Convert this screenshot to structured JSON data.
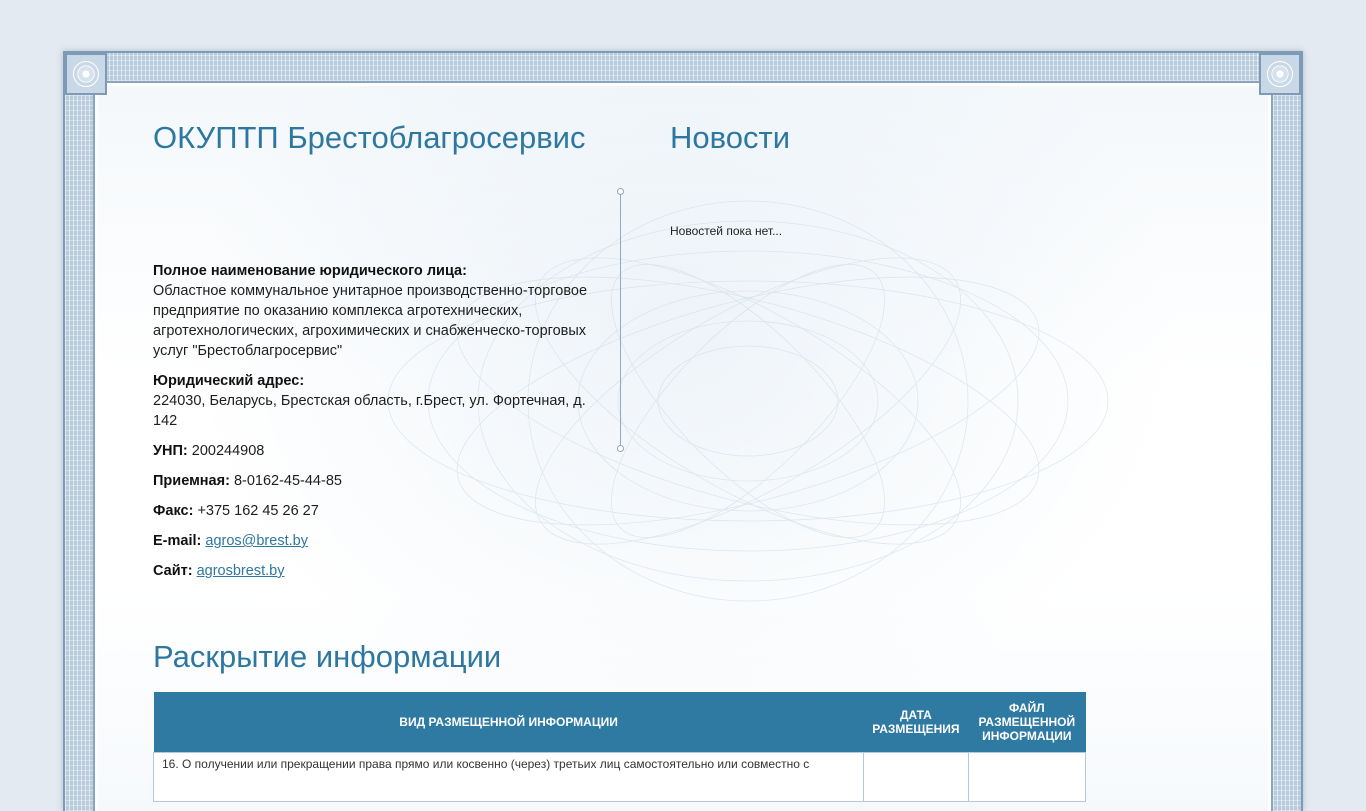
{
  "company": {
    "title": "ОКУПТП Брестоблагросервис",
    "full_name_label": "Полное наименование юридического лица:",
    "full_name_value": "Областное коммунальное унитарное производственно-торговое предприятие по оказанию комплекса агротехнических, агротехнологических, агрохимических и снабженческо-торговых услуг \"Брестоблагросервис\"",
    "address_label": "Юридический адрес:",
    "address_value": "224030, Беларусь, Брестская область, г.Брест, ул. Фортечная, д. 142",
    "unp_label": "УНП:",
    "unp_value": "200244908",
    "reception_label": "Приемная:",
    "reception_value": "8-0162-45-44-85",
    "fax_label": "Факс:",
    "fax_value": "+375 162 45 26 27",
    "email_label": "E-mail:",
    "email_value": "agros@brest.by",
    "site_label": "Сайт:",
    "site_value": "agrosbrest.by"
  },
  "news": {
    "title": "Новости",
    "empty_text": "Новостей пока нет..."
  },
  "disclosure": {
    "title": "Раскрытие информации",
    "columns": [
      "Вид размещенной информации",
      "Дата размещения",
      "Файл размещенной информации"
    ],
    "rows": [
      {
        "text": "16. О получении или прекращении права прямо или косвенно (через) третьих лиц самостоятельно или совместно с",
        "date": "",
        "file": ""
      }
    ]
  }
}
